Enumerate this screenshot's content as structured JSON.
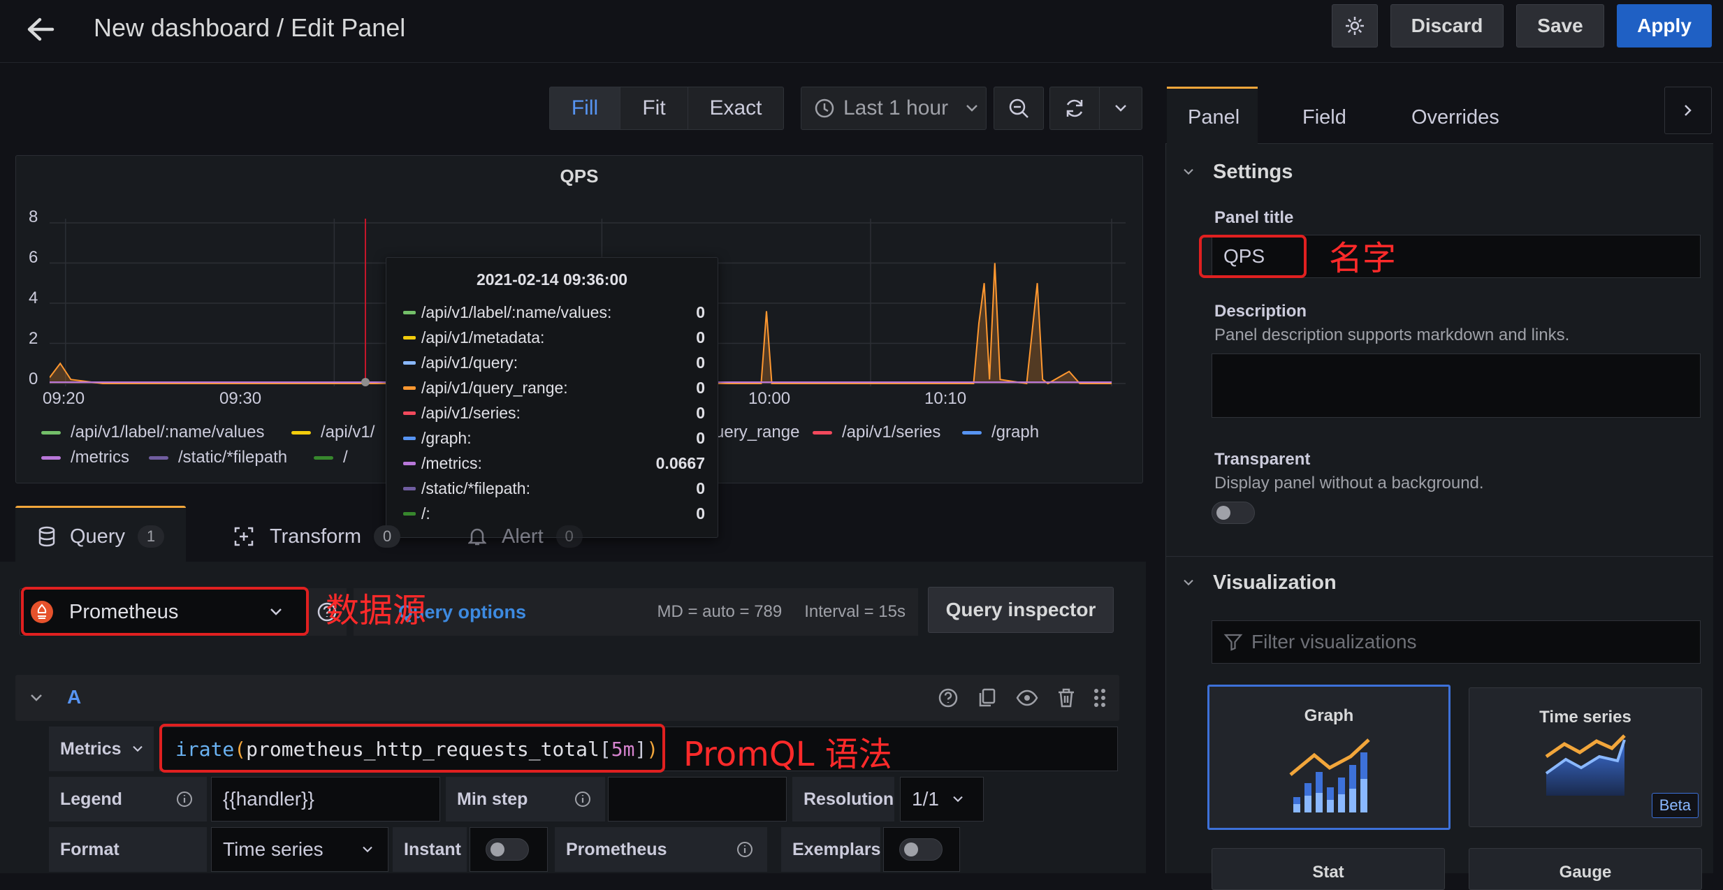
{
  "header": {
    "title": "New dashboard / Edit Panel",
    "discard_label": "Discard",
    "save_label": "Save",
    "apply_label": "Apply"
  },
  "toolbar": {
    "fill_label": "Fill",
    "fit_label": "Fit",
    "exact_label": "Exact",
    "time_range": "Last 1 hour"
  },
  "panel": {
    "title": "QPS",
    "tooltip": {
      "time": "2021-02-14 09:36:00",
      "rows": [
        {
          "name": "/api/v1/label/:name/values:",
          "value": "0",
          "color": "#73bf69"
        },
        {
          "name": "/api/v1/metadata:",
          "value": "0",
          "color": "#f2cc0c"
        },
        {
          "name": "/api/v1/query:",
          "value": "0",
          "color": "#8ab8ff"
        },
        {
          "name": "/api/v1/query_range:",
          "value": "0",
          "color": "#ff9830"
        },
        {
          "name": "/api/v1/series:",
          "value": "0",
          "color": "#f2495c"
        },
        {
          "name": "/graph:",
          "value": "0",
          "color": "#5794f2"
        },
        {
          "name": "/metrics:",
          "value": "0.0667",
          "color": "#b877d9"
        },
        {
          "name": "/static/*filepath:",
          "value": "0",
          "color": "#705da0"
        },
        {
          "name": "/:",
          "value": "0",
          "color": "#37872d"
        }
      ]
    },
    "legend_row1": [
      {
        "name": "/api/v1/label/:name/values",
        "color": "#73bf69"
      },
      {
        "name": "/api/v1/",
        "color": "#f2cc0c"
      },
      {
        "name": "uery_range",
        "color": "#ff9830"
      },
      {
        "name": "/api/v1/series",
        "color": "#f2495c"
      },
      {
        "name": "/graph",
        "color": "#5794f2"
      }
    ],
    "legend_row2": [
      {
        "name": "/metrics",
        "color": "#b877d9"
      },
      {
        "name": "/static/*filepath",
        "color": "#705da0"
      },
      {
        "name": "/",
        "color": "#37872d"
      }
    ]
  },
  "chart_data": {
    "type": "line",
    "title": "QPS",
    "ylim": [
      0,
      8
    ],
    "yticks": [
      "0",
      "2",
      "4",
      "6",
      "8"
    ],
    "xticks": [
      "09:20",
      "09:30",
      "10:00",
      "10:10"
    ],
    "series": [
      {
        "name": "/api/v1/query_range",
        "color": "#ff9830",
        "points": [
          [
            0.0,
            0.3
          ],
          [
            0.01,
            1.0
          ],
          [
            0.02,
            0.2
          ],
          [
            0.05,
            0.0
          ],
          [
            0.45,
            0.0
          ],
          [
            0.5,
            0.0
          ],
          [
            0.67,
            0.0
          ],
          [
            0.675,
            3.6
          ],
          [
            0.68,
            0.0
          ],
          [
            0.87,
            0.0
          ],
          [
            0.875,
            3.0
          ],
          [
            0.88,
            5.0
          ],
          [
            0.885,
            0.2
          ],
          [
            0.89,
            6.0
          ],
          [
            0.895,
            0.2
          ],
          [
            0.92,
            0.0
          ],
          [
            0.93,
            5.0
          ],
          [
            0.935,
            0.2
          ],
          [
            0.94,
            0.0
          ],
          [
            0.96,
            0.6
          ],
          [
            0.97,
            0.0
          ],
          [
            1.0,
            0.0
          ]
        ]
      },
      {
        "name": "/metrics",
        "color": "#b877d9",
        "points": [
          [
            0.0,
            0.07
          ],
          [
            1.0,
            0.07
          ]
        ]
      }
    ]
  },
  "query_tabs": {
    "query_label": "Query",
    "query_count": "1",
    "transform_label": "Transform",
    "transform_count": "0",
    "alert_label": "Alert",
    "alert_count": "0"
  },
  "datasource": {
    "name": "Prometheus",
    "query_options": "Query options",
    "md": "MD = auto = 789",
    "interval": "Interval = 15s",
    "inspector": "Query inspector"
  },
  "query": {
    "ref": "A",
    "metrics_label": "Metrics",
    "expr_fn": "irate",
    "expr_open": "(",
    "expr_metric": "prometheus_http_requests_total",
    "expr_lb": "[",
    "expr_range": "5m",
    "expr_rb": "]",
    "expr_close": ")",
    "legend_label": "Legend",
    "legend_value": "{{handler}}",
    "minstep_label": "Min step",
    "resolution_label": "Resolution",
    "resolution_value": "1/1",
    "format_label": "Format",
    "format_value": "Time series",
    "instant_label": "Instant",
    "prometheus_label": "Prometheus",
    "exemplars_label": "Exemplars"
  },
  "annotations": {
    "name": "名字",
    "datasource": "数据源",
    "promql": "PromQL 语法"
  },
  "options": {
    "tabs": [
      "Panel",
      "Field",
      "Overrides"
    ],
    "settings_title": "Settings",
    "panel_title_label": "Panel title",
    "panel_title_value": "QPS",
    "description_label": "Description",
    "description_hint": "Panel description supports markdown and links.",
    "transparent_label": "Transparent",
    "transparent_hint": "Display panel without a background.",
    "visualization_title": "Visualization",
    "filter_placeholder": "Filter visualizations",
    "viz": [
      {
        "name": "Graph"
      },
      {
        "name": "Time series",
        "badge": "Beta"
      },
      {
        "name": "Stat"
      },
      {
        "name": "Gauge"
      }
    ]
  },
  "colors": {
    "accent": "#1f60c4",
    "annotation": "#ff2a2a",
    "tab_active": "#f2a63b"
  }
}
